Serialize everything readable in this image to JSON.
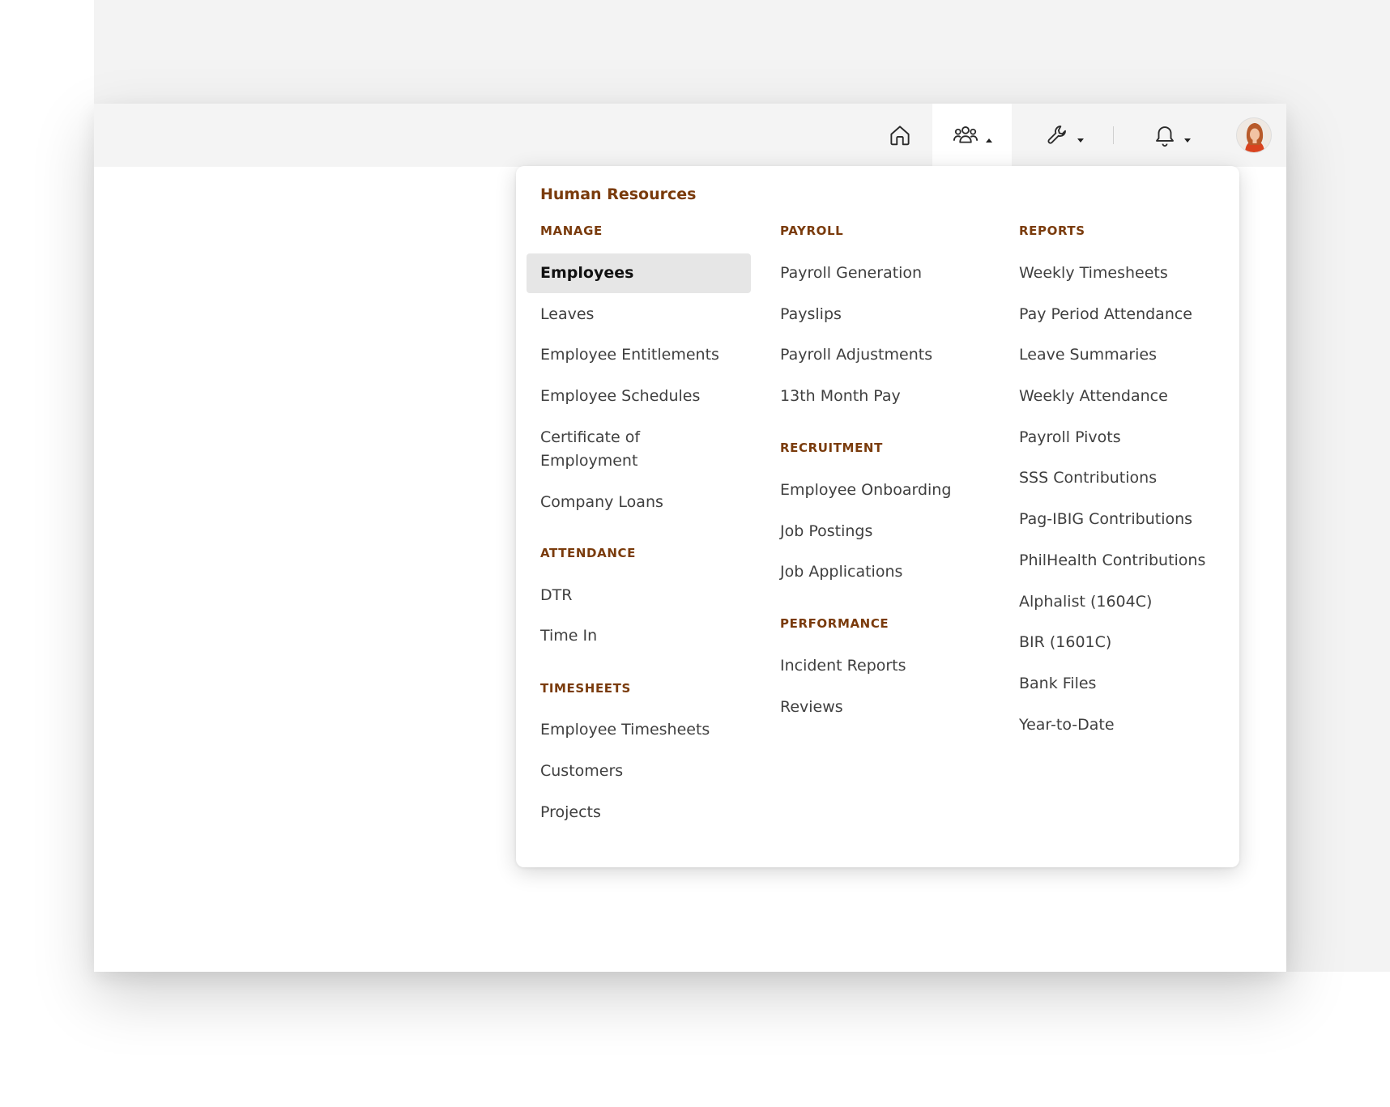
{
  "nav": {
    "home_icon": "home-icon",
    "hr_icon": "people-icon",
    "tools_icon": "wrench-icon",
    "notifications_icon": "bell-icon",
    "active": "human-resources",
    "accent_color": "#7a3b0c"
  },
  "menu": {
    "title": "Human Resources",
    "manage": {
      "heading": "MANAGE",
      "items": [
        "Employees",
        "Leaves",
        "Employee Entitlements",
        "Employee Schedules",
        "Certificate of Employment",
        "Company Loans"
      ],
      "selected": "Employees"
    },
    "attendance": {
      "heading": "ATTENDANCE",
      "items": [
        "DTR",
        "Time In"
      ]
    },
    "timesheets": {
      "heading": "TIMESHEETS",
      "items": [
        "Employee Timesheets",
        "Customers",
        "Projects"
      ]
    },
    "payroll": {
      "heading": "PAYROLL",
      "items": [
        "Payroll Generation",
        "Payslips",
        "Payroll Adjustments",
        "13th Month Pay"
      ]
    },
    "recruitment": {
      "heading": "RECRUITMENT",
      "items": [
        "Employee Onboarding",
        "Job Postings",
        "Job Applications"
      ]
    },
    "performance": {
      "heading": "PERFORMANCE",
      "items": [
        "Incident Reports",
        "Reviews"
      ]
    },
    "reports": {
      "heading": "REPORTS",
      "items": [
        "Weekly Timesheets",
        "Pay Period Attendance",
        "Leave Summaries",
        "Weekly Attendance",
        "Payroll Pivots",
        "SSS Contributions",
        "Pag-IBIG Contributions",
        "PhilHealth Contributions",
        "Alphalist (1604C)",
        "BIR (1601C)",
        "Bank Files",
        "Year-to-Date"
      ]
    }
  }
}
